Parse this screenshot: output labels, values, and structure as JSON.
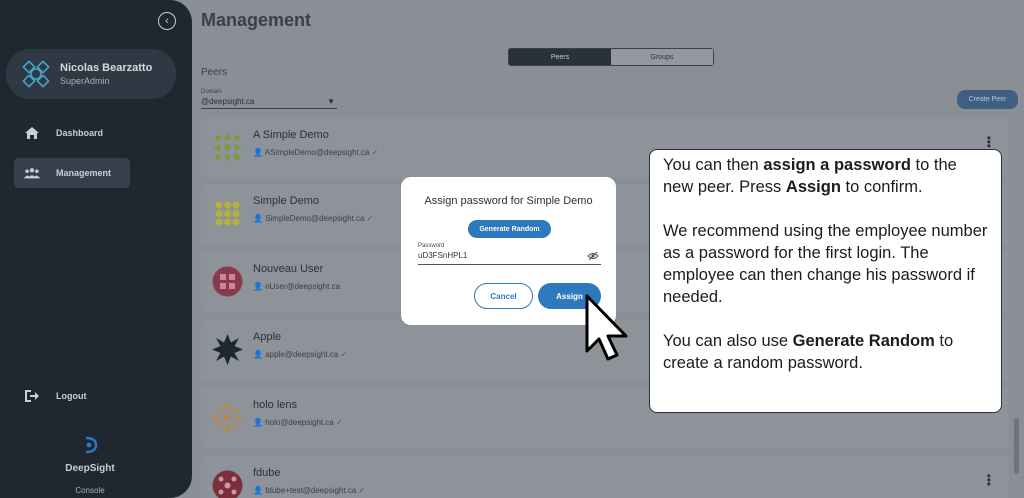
{
  "sidebar": {
    "profile": {
      "name": "Nicolas Bearzatto",
      "role": "SuperAdmin"
    },
    "nav": [
      {
        "label": "Dashboard",
        "icon": "home-icon"
      },
      {
        "label": "Management",
        "icon": "users-icon"
      }
    ],
    "logout_label": "Logout",
    "brand": {
      "name": "DeepSight",
      "sub": "Console"
    }
  },
  "main": {
    "title": "Management",
    "tabs": [
      {
        "label": "Peers",
        "active": true
      },
      {
        "label": "Groups",
        "active": false
      }
    ],
    "section_label": "Peers",
    "domain": {
      "caption": "Domain",
      "value": "@deepsight.ca"
    },
    "create_peer_label": "Create Peer",
    "peers": [
      {
        "name": "A Simple Demo",
        "email": "ASimpleDemo@deepsight.ca",
        "verified": true,
        "avatar_color": "#7d9a3a"
      },
      {
        "name": "Simple Demo",
        "email": "SimpleDemo@deepsight.ca",
        "verified": true,
        "avatar_color": "#b5b23a"
      },
      {
        "name": "Nouveau User",
        "email": "nUser@deepsight.ca",
        "verified": false,
        "avatar_color": "#8a3a4e"
      },
      {
        "name": "Apple",
        "email": "apple@deepsight.ca",
        "verified": true,
        "avatar_color": "#1c2830"
      },
      {
        "name": "holo lens",
        "email": "holo@deepsight.ca",
        "verified": true,
        "avatar_color": "#b08a50"
      },
      {
        "name": "fdube",
        "email": "fdube+test@deepsight.ca",
        "verified": true,
        "avatar_color": "#7a2f3a"
      }
    ]
  },
  "modal": {
    "title": "Assign password for Simple Demo",
    "generate_label": "Generate Random",
    "password_caption": "Password",
    "password_value": "uD3FSnHPL1",
    "cancel_label": "Cancel",
    "assign_label": "Assign"
  },
  "callout": {
    "p1_a": "You can then ",
    "p1_b": "assign a password",
    "p1_c": " to the new peer. Press ",
    "p1_d": "Assign",
    "p1_e": " to confirm.",
    "p2": "We recommend using the employee number as a password for the first login. The employee can then change his password if needed.",
    "p3_a": "You can also use ",
    "p3_b": "Generate Random",
    "p3_c": " to create a random password."
  },
  "colors": {
    "accent": "#2e78be",
    "sidebar": "#1f2731",
    "overlay": "#8a8f96"
  }
}
